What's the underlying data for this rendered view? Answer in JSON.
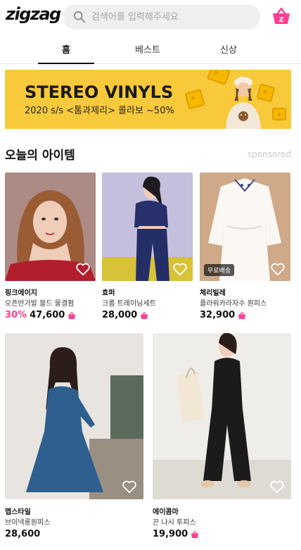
{
  "header": {
    "logo": "zigzag",
    "search_placeholder": "검색어를 입력해주세요",
    "accent": "#ff3f8f"
  },
  "tabs": [
    {
      "label": "홈",
      "active": true
    },
    {
      "label": "베스트",
      "active": false
    },
    {
      "label": "신상",
      "active": false
    }
  ],
  "banner": {
    "title": "STEREO VINYLS",
    "subtitle": "2020 s/s <톰과제리> 콜라보 ~50%",
    "bg_color": "#f8c93a"
  },
  "section": {
    "title": "오늘의 아이템",
    "sponsored_label": "sponsored"
  },
  "products": [
    {
      "brand": "핑크에이지",
      "name": "오픈반가발 블드 물결펌",
      "discount": "30%",
      "price": "47,600",
      "free_shipping": ""
    },
    {
      "brand": "효퍼",
      "name": "크롭 트레이닝세트",
      "discount": "",
      "price": "28,000",
      "free_shipping": ""
    },
    {
      "brand": "체리빌레",
      "name": "플라워카라자수 원피스",
      "discount": "",
      "price": "32,900",
      "free_shipping": "무료배송"
    },
    {
      "brand": "멥스타일",
      "name": "브이넥롱원피스",
      "discount": "",
      "price": "28,600",
      "free_shipping": ""
    },
    {
      "brand": "에이콤마",
      "name": "끈 나시 투피스",
      "discount": "",
      "price": "19,900",
      "free_shipping": ""
    }
  ]
}
